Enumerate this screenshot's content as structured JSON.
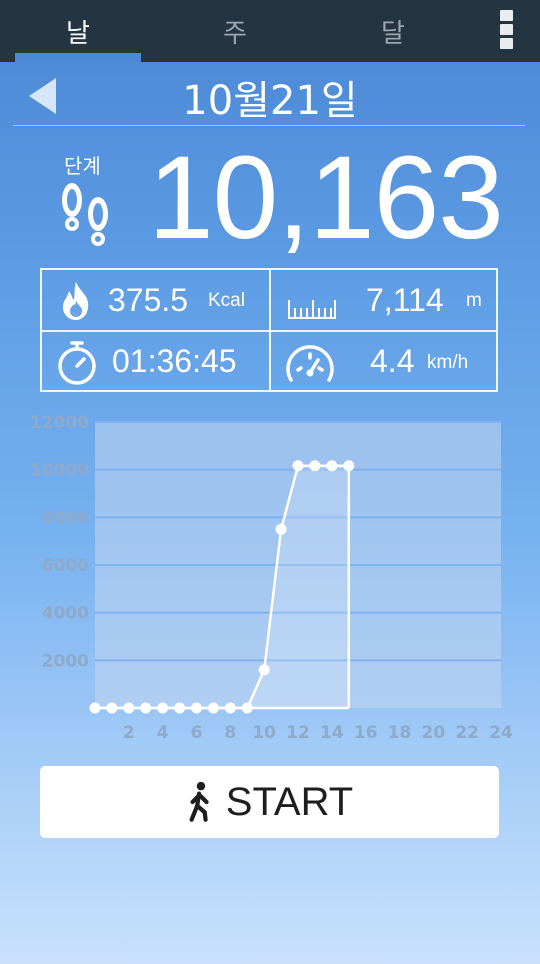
{
  "tabs": [
    {
      "label": "날",
      "active": true
    },
    {
      "label": "주",
      "active": false
    },
    {
      "label": "달",
      "active": false
    }
  ],
  "header": {
    "date": "10월21일"
  },
  "steps": {
    "label": "단계",
    "value": "10,163"
  },
  "stats": {
    "calories": {
      "value": "375.5",
      "unit": "Kcal"
    },
    "distance": {
      "value": "7,114",
      "unit": "m"
    },
    "duration": {
      "value": "01:36:45",
      "unit": ""
    },
    "speed": {
      "value": "4.4",
      "unit": "km/h"
    }
  },
  "chart_data": {
    "type": "area",
    "x": [
      0,
      1,
      2,
      3,
      4,
      5,
      6,
      7,
      8,
      9,
      10,
      11,
      12,
      13,
      14,
      15
    ],
    "values": [
      0,
      0,
      0,
      0,
      0,
      0,
      0,
      0,
      0,
      0,
      1600,
      7500,
      10163,
      10163,
      10163,
      10163
    ],
    "xticks": [
      2,
      4,
      6,
      8,
      10,
      12,
      14,
      16,
      18,
      20,
      22,
      24
    ],
    "yticks": [
      2000,
      4000,
      6000,
      8000,
      10000,
      12000
    ],
    "xlim": [
      0,
      24
    ],
    "ylim": [
      0,
      12000
    ],
    "grid": true,
    "colors": {
      "line": "#ffffff",
      "grid": "#7fb2ee",
      "plot_bg": "#c2d6f0",
      "tick": "#8fa9c8"
    }
  },
  "start_button": {
    "label": "START"
  }
}
